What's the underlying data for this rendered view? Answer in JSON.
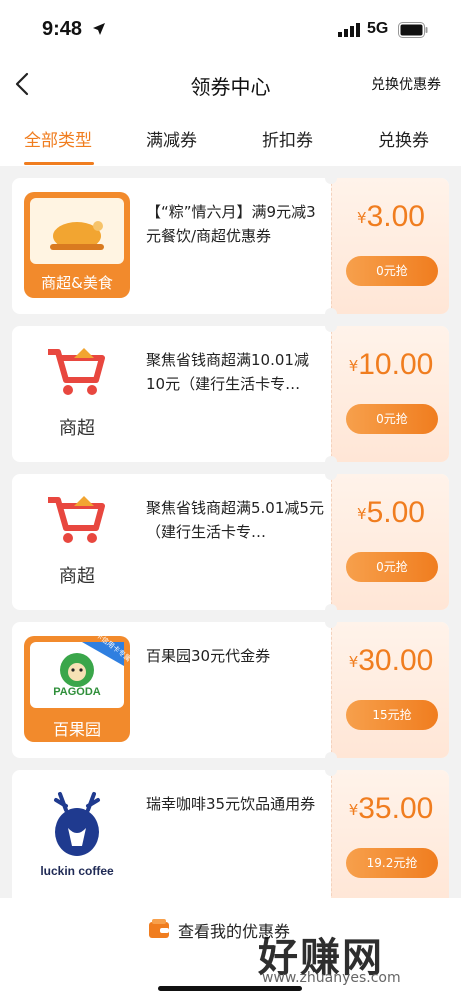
{
  "status": {
    "time": "9:48",
    "network": "5G"
  },
  "nav": {
    "title": "领券中心",
    "action": "兑换优惠券"
  },
  "tabs": [
    {
      "label": "全部类型",
      "active": true
    },
    {
      "label": "满减券",
      "active": false
    },
    {
      "label": "折扣券",
      "active": false
    },
    {
      "label": "兑换券",
      "active": false
    }
  ],
  "coupons": [
    {
      "category": "商超&美食",
      "title": "【“粽”情六月】满9元减3元餐饮/商超优惠券",
      "currency": "¥",
      "amount": "3.00",
      "button": "0元抢"
    },
    {
      "category": "商超",
      "title": "聚焦省钱商超满10.01减10元（建行生活卡专…",
      "currency": "¥",
      "amount": "10.00",
      "button": "0元抢"
    },
    {
      "category": "商超",
      "title": "聚焦省钱商超满5.01减5元（建行生活卡专…",
      "currency": "¥",
      "amount": "5.00",
      "button": "0元抢"
    },
    {
      "category": "百果园",
      "badge": "龙卡信用卡专属",
      "logo_text": "PAGODA",
      "title": "百果园30元代金券",
      "currency": "¥",
      "amount": "30.00",
      "button": "15元抢"
    },
    {
      "category": "luckin coffee",
      "title": "瑞幸咖啡35元饮品通用券",
      "currency": "¥",
      "amount": "35.00",
      "button": "19.2元抢"
    }
  ],
  "bottom": {
    "link": "查看我的优惠券"
  },
  "watermark": {
    "text": "好赚网",
    "url": "www.zhuanyes.com"
  },
  "colors": {
    "accent": "#f07d1f",
    "accent_light": "#f7a04c"
  }
}
